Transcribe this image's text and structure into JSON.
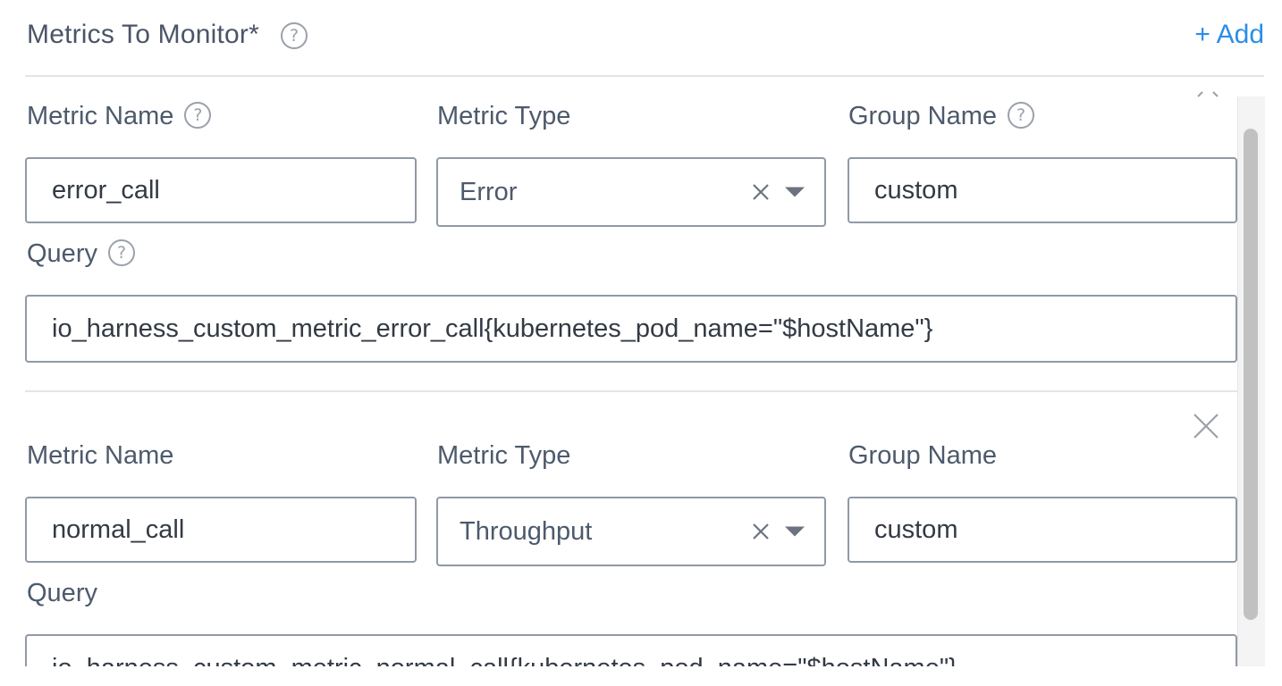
{
  "header": {
    "title": "Metrics To Monitor*",
    "help_glyph": "?",
    "add_label": "+ Add"
  },
  "metrics": [
    {
      "metric_name_label": "Metric Name",
      "metric_type_label": "Metric Type",
      "group_name_label": "Group Name",
      "query_label": "Query",
      "metric_name": "error_call",
      "metric_type": "Error",
      "group_name": "custom",
      "query": "io_harness_custom_metric_error_call{kubernetes_pod_name=\"$hostName\"}"
    },
    {
      "metric_name_label": "Metric Name",
      "metric_type_label": "Metric Type",
      "group_name_label": "Group Name",
      "query_label": "Query",
      "metric_name": "normal_call",
      "metric_type": "Throughput",
      "group_name": "custom",
      "query": "io_harness_custom_metric_normal_call{kubernetes_pod_name=\"$hostName\"}"
    }
  ],
  "colors": {
    "accent": "#2b8ee8",
    "label": "#4d5a6c",
    "border": "#9099a6"
  },
  "icons": {
    "help": "help-circle-icon",
    "clear": "clear-x-icon",
    "caret": "caret-down-icon",
    "remove": "close-icon"
  }
}
